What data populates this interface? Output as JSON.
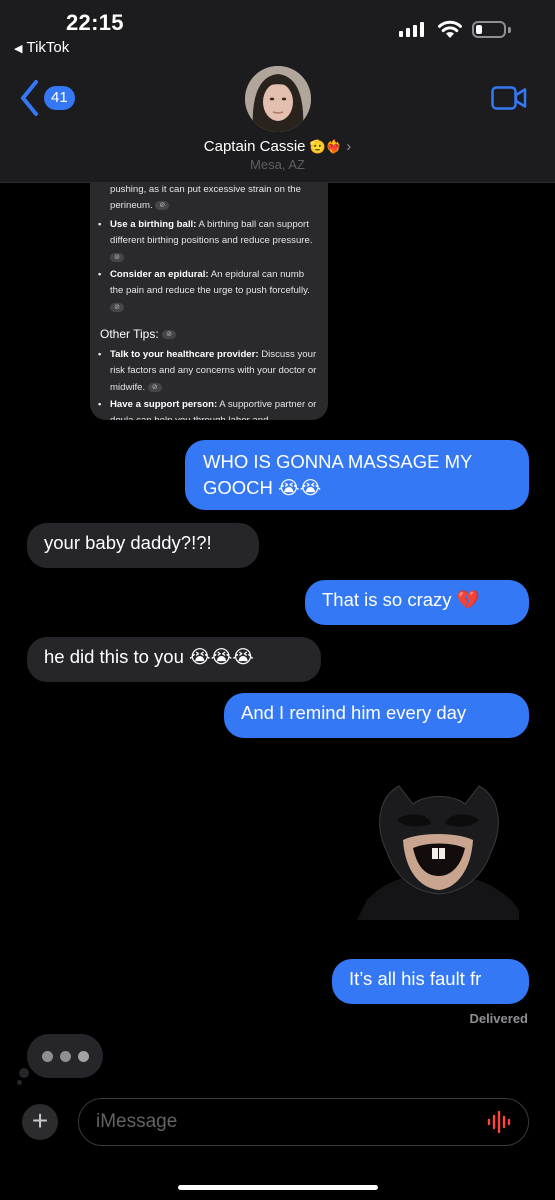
{
  "status_bar": {
    "time": "22:15",
    "back_app": "TikTok",
    "back_arrow": "◀"
  },
  "header": {
    "unread_count": "41",
    "contact_name": "Captain Cassie",
    "contact_emoji": "🫡❤️‍🔥",
    "contact_chevron": "›",
    "contact_location": "Mesa, AZ"
  },
  "shared_card": {
    "partial_top": "pushing, as it can put excessive strain on the perineum.",
    "items": [
      {
        "title": "Use a birthing ball:",
        "text": " A birthing ball can support different birthing positions and reduce pressure."
      },
      {
        "title": "Consider an epidural:",
        "text": " An epidural can numb the pain and reduce the urge to push forcefully."
      }
    ],
    "heading": "Other Tips:",
    "tips": [
      {
        "title": "Talk to your healthcare provider:",
        "text": " Discuss your risk factors and any concerns with your doctor or midwife."
      },
      {
        "title": "Have a support person:",
        "text": " A supportive partner or doula can help you through labor and"
      }
    ],
    "link_glyph": "⊘"
  },
  "messages": [
    {
      "side": "sent",
      "text": "WHO IS GONNA MASSAGE MY GOOCH 😭😭"
    },
    {
      "side": "received",
      "text": "your baby daddy?!?!"
    },
    {
      "side": "sent",
      "text": "That is so crazy 💔"
    },
    {
      "side": "received",
      "text": "he did this to you 😭😭😭"
    },
    {
      "side": "sent",
      "text": "And I remind him every day"
    },
    {
      "side": "sent",
      "text": "It’s all his fault fr"
    }
  ],
  "delivered_label": "Delivered",
  "input": {
    "plus_label": "+",
    "placeholder": "iMessage"
  },
  "colors": {
    "sent_bubble": "#3478f6",
    "received_bubble": "#26252a",
    "header_bg": "#1c1c1e",
    "accent": "#3478f6",
    "audio_icon": "#ff453a"
  }
}
